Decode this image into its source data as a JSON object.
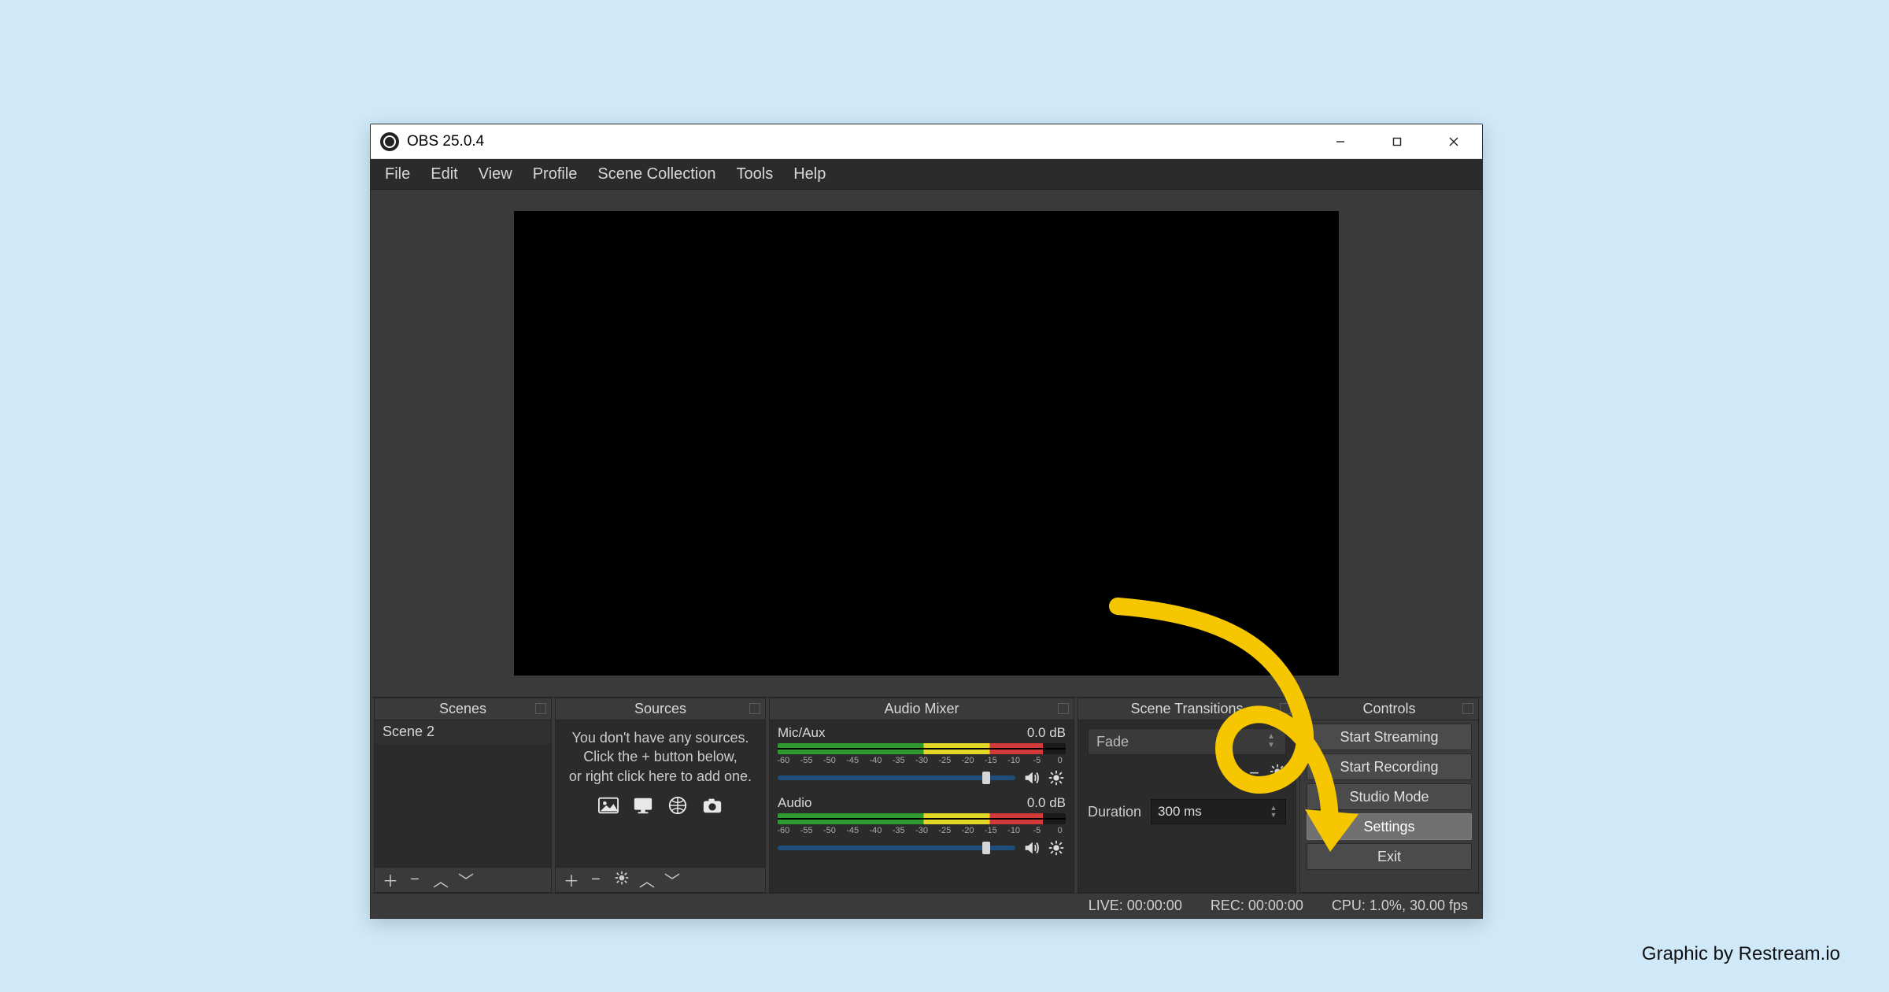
{
  "titlebar": {
    "title": "OBS 25.0.4"
  },
  "menubar": {
    "items": [
      "File",
      "Edit",
      "View",
      "Profile",
      "Scene Collection",
      "Tools",
      "Help"
    ]
  },
  "docks": {
    "scenes": {
      "title": "Scenes",
      "items": [
        "Scene 2"
      ]
    },
    "sources": {
      "title": "Sources",
      "empty_text": {
        "l1": "You don't have any sources.",
        "l2": "Click the + button below,",
        "l3": "or right click here to add one."
      }
    },
    "mixer": {
      "title": "Audio Mixer",
      "channels": [
        {
          "name": "Mic/Aux",
          "db": "0.0 dB",
          "slider_pct": 86,
          "meter_pct": 92
        },
        {
          "name": "Audio",
          "db": "0.0 dB",
          "slider_pct": 86,
          "meter_pct": 92
        }
      ],
      "tick_labels": [
        "-60",
        "-55",
        "-50",
        "-45",
        "-40",
        "-35",
        "-30",
        "-25",
        "-20",
        "-15",
        "-10",
        "-5",
        "0"
      ]
    },
    "transitions": {
      "title": "Scene Transitions",
      "selected": "Fade",
      "duration_label": "Duration",
      "duration_value": "300 ms"
    },
    "controls": {
      "title": "Controls",
      "buttons": [
        {
          "label": "Start Streaming",
          "key": "start-streaming",
          "highlight": false
        },
        {
          "label": "Start Recording",
          "key": "start-recording",
          "highlight": false
        },
        {
          "label": "Studio Mode",
          "key": "studio-mode",
          "highlight": false
        },
        {
          "label": "Settings",
          "key": "settings",
          "highlight": true
        },
        {
          "label": "Exit",
          "key": "exit",
          "highlight": false
        }
      ]
    }
  },
  "statusbar": {
    "live": "LIVE: 00:00:00",
    "rec": "REC: 00:00:00",
    "cpu": "CPU: 1.0%, 30.00 fps"
  },
  "attribution": "Graphic by Restream.io"
}
